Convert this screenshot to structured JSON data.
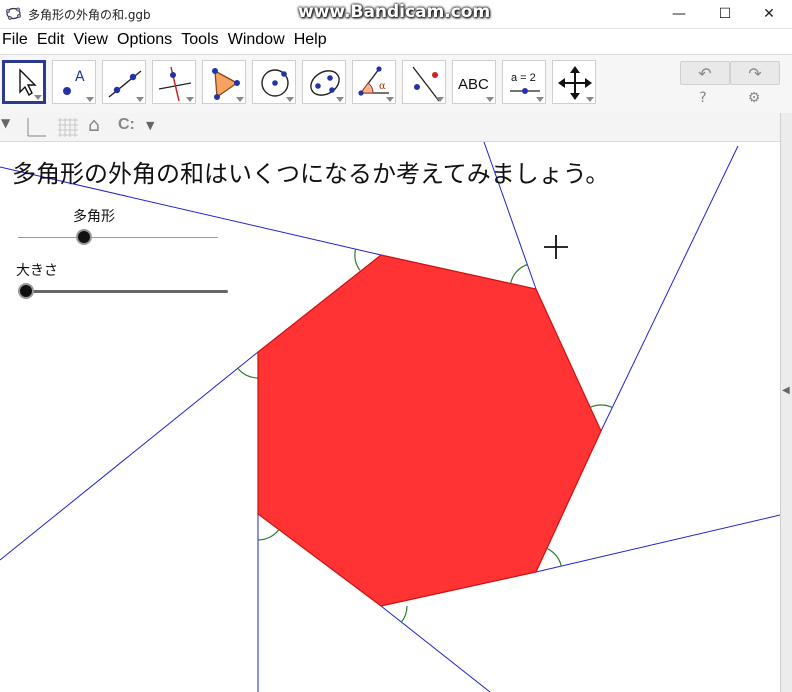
{
  "window": {
    "title": "多角形の外角の和.ggb",
    "watermark": "www.Bandicam.com",
    "minimize": "—",
    "maximize": "☐",
    "close": "✕"
  },
  "menu": [
    "File",
    "Edit",
    "View",
    "Options",
    "Tools",
    "Window",
    "Help"
  ],
  "toolbar": {
    "tools": [
      {
        "icon": "move-arrow-icon"
      },
      {
        "icon": "point-icon",
        "text": "A"
      },
      {
        "icon": "line-icon"
      },
      {
        "icon": "perpendicular-line-icon"
      },
      {
        "icon": "polygon-icon"
      },
      {
        "icon": "circle-icon"
      },
      {
        "icon": "ellipse-icon"
      },
      {
        "icon": "angle-icon",
        "text": "α"
      },
      {
        "icon": "reflect-icon"
      },
      {
        "icon": "text-icon",
        "text": "ABC"
      },
      {
        "icon": "slider-icon",
        "text": "a = 2"
      },
      {
        "icon": "move-graphics-icon"
      }
    ],
    "undo": "↶",
    "redo": "↷",
    "help": "?",
    "settings": "⚙"
  },
  "stylebar": {
    "style_arrow": "▼",
    "home": "⌂",
    "point_capture": "C:",
    "dropdown": "▼"
  },
  "canvas": {
    "question": "多角形の外角の和はいくつになるか考えてみましょう。",
    "sliders": [
      {
        "label": "多角形",
        "value_fraction": 0.33
      },
      {
        "label": "大きさ",
        "value_fraction": 0.0
      }
    ],
    "polygon_color": "#ff3333",
    "line_color": "#2222cc",
    "arc_color": "#2e7d32"
  },
  "rightbar": {
    "arrow": "◀"
  }
}
